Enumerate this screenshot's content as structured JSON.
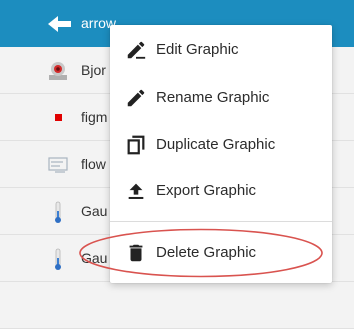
{
  "list": {
    "rows": [
      {
        "label": "arrow",
        "icon": "arrow-graphic-icon"
      },
      {
        "label": "Bjor",
        "icon": "bjor-graphic-icon"
      },
      {
        "label": "figm",
        "icon": "figure-graphic-icon"
      },
      {
        "label": "flow",
        "icon": "flow-graphic-icon"
      },
      {
        "label": "Gau",
        "icon": "gauge-graphic-icon"
      },
      {
        "label": "Gau",
        "icon": "gauge-graphic-icon"
      }
    ]
  },
  "context_menu": {
    "items": [
      {
        "label": "Edit Graphic",
        "icon": "edit-pencil-icon"
      },
      {
        "label": "Rename Graphic",
        "icon": "rename-pencil-icon"
      },
      {
        "label": "Duplicate Graphic",
        "icon": "duplicate-icon"
      },
      {
        "label": "Export Graphic",
        "icon": "export-upload-icon"
      },
      {
        "label": "Delete Graphic",
        "icon": "trash-icon"
      }
    ]
  },
  "colors": {
    "selected_row": "#1c8dbf",
    "row_background": "#f3f3f3",
    "highlight_ellipse": "#d9534f",
    "icon_dark": "#222222"
  }
}
